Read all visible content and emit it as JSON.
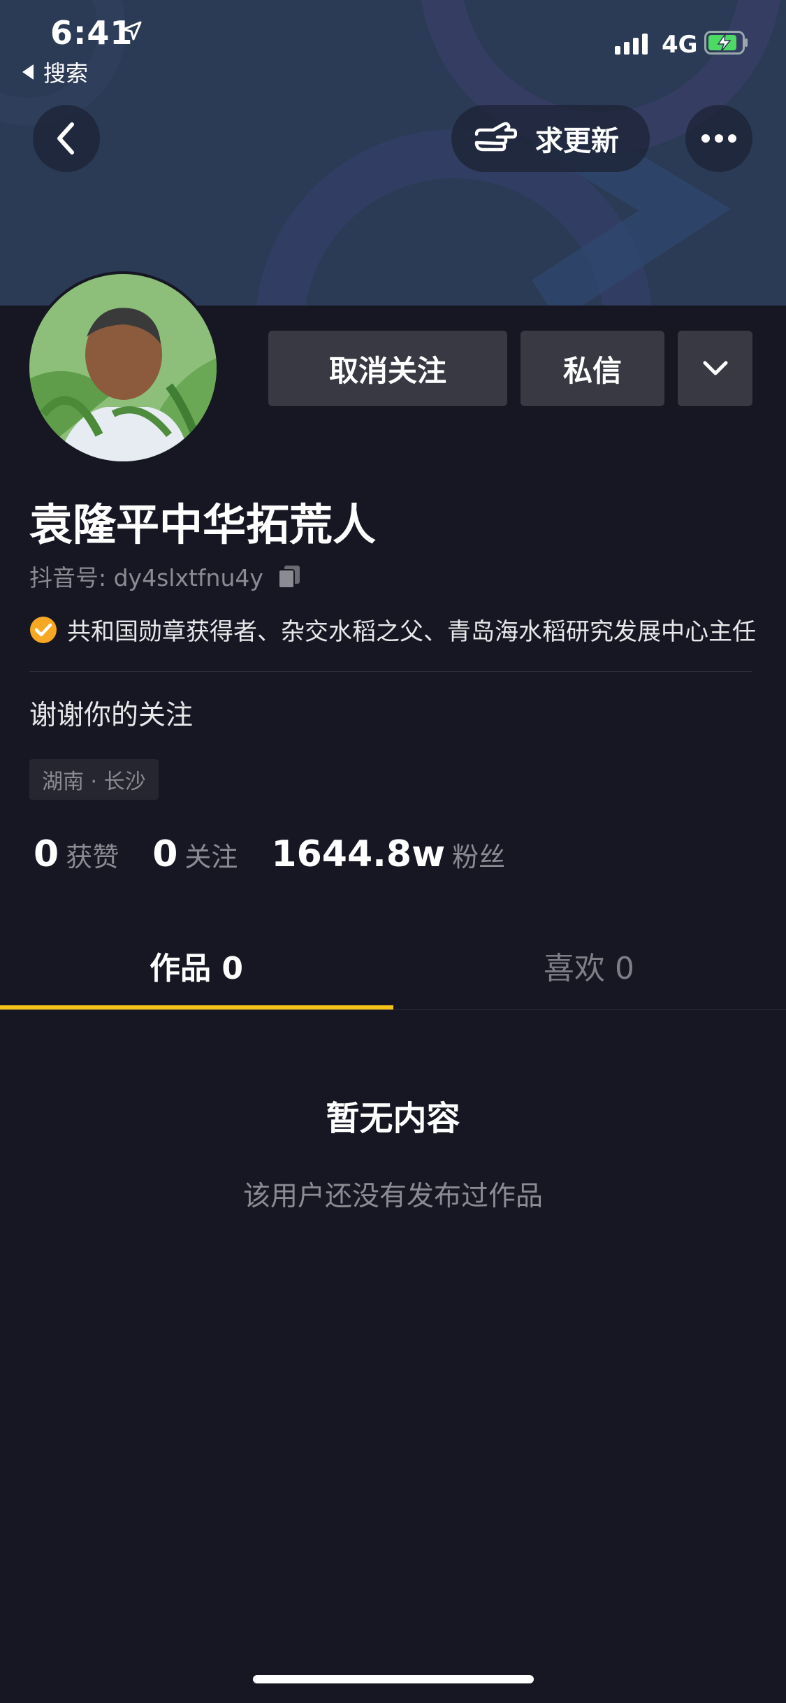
{
  "status_bar": {
    "time": "6:41",
    "back_app_label": "搜索",
    "network": "4G"
  },
  "nav": {
    "back_icon": "chevron-left-icon",
    "update_label": "求更新",
    "more_icon": "more-dots-icon"
  },
  "actions": {
    "unfollow_label": "取消关注",
    "message_label": "私信"
  },
  "profile": {
    "name": "袁隆平中华拓荒人",
    "douyin_id": "抖音号: dy4slxtfnu4y",
    "verification": "共和国勋章获得者、杂交水稻之父、青岛海水稻研究发展中心主任",
    "bio": "谢谢你的关注",
    "location_tag": "湖南 · 长沙"
  },
  "stats": [
    {
      "value": "0",
      "label": "获赞"
    },
    {
      "value": "0",
      "label": "关注"
    },
    {
      "value": "1644.8w",
      "label": "粉丝"
    }
  ],
  "tabs": [
    {
      "label": "作品 0",
      "active": true
    },
    {
      "label": "喜欢 0",
      "active": false
    }
  ],
  "empty_state": {
    "title": "暂无内容",
    "subtitle": "该用户还没有发布过作品"
  },
  "colors": {
    "background": "#161722",
    "accent_tab": "#f5c418",
    "verify_badge": "#f7a823",
    "battery_green": "#4cd964"
  }
}
